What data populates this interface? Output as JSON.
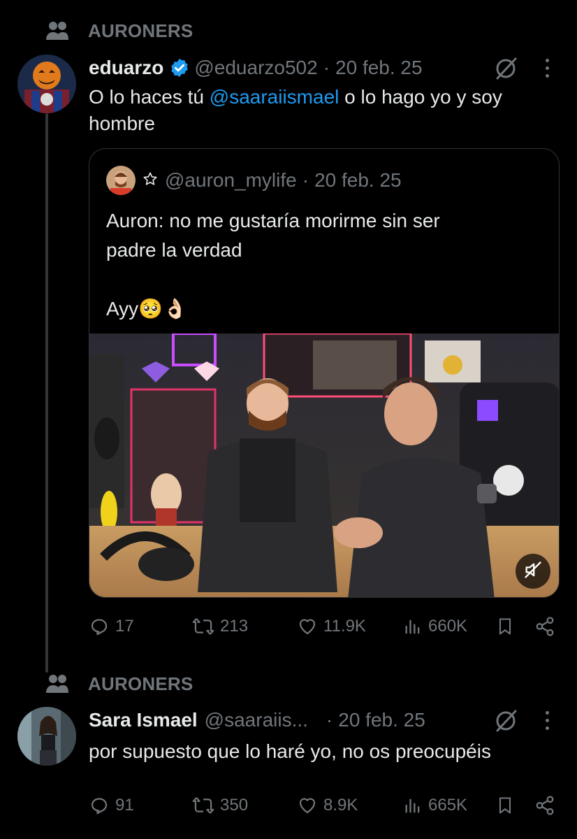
{
  "community_1": {
    "name": "AURONERS"
  },
  "tweet_1": {
    "display_name": "eduarzo",
    "handle": "@eduarzo502",
    "separator": "·",
    "date": "20 feb. 25",
    "text_before": "O lo haces tú ",
    "mention": "@saaraiismael",
    "text_after": " o lo hago yo y soy",
    "text_line2": "hombre",
    "quoted": {
      "handle": "@auron_mylife",
      "separator": "·",
      "date": "20 feb. 25",
      "line1": "Auron: no me gustaría morirme sin ser",
      "line2": "padre la verdad",
      "line3": "Ayy🥺👌🏻"
    },
    "stats": {
      "replies": "17",
      "reposts": "213",
      "likes": "11.9K",
      "views": "660K"
    }
  },
  "community_2": {
    "name": "AURONERS"
  },
  "tweet_2": {
    "display_name": "Sara Ismael",
    "handle": "@saaraiis...",
    "separator": "·",
    "date": "20 feb. 25",
    "text": "por supuesto que lo haré yo, no os preocupéis",
    "stats": {
      "replies": "91",
      "reposts": "350",
      "likes": "8.9K",
      "views": "665K"
    }
  },
  "colors": {
    "background": "#000000",
    "text": "#e7e9ea",
    "muted": "#71767b",
    "accent": "#1d9bf0",
    "border": "#2f3336"
  }
}
